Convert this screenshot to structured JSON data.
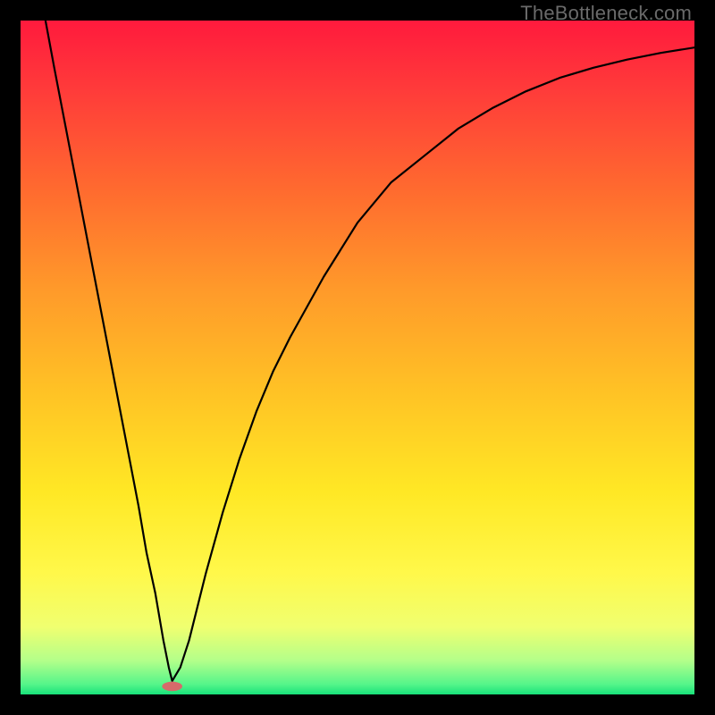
{
  "watermark": "TheBottleneck.com",
  "chart_data": {
    "type": "line",
    "title": "",
    "xlabel": "",
    "ylabel": "",
    "xlim": [
      0,
      100
    ],
    "ylim": [
      0,
      100
    ],
    "grid": false,
    "series": [
      {
        "name": "curve",
        "x": [
          3.7,
          5,
          7.5,
          10,
          12.5,
          15,
          17.5,
          18.7,
          20,
          21.2,
          22,
          22.5,
          23.7,
          25,
          27.5,
          30,
          32.5,
          35,
          37.5,
          40,
          45,
          50,
          55,
          60,
          65,
          70,
          75,
          80,
          85,
          90,
          95,
          100
        ],
        "y": [
          100,
          93,
          80,
          67,
          54,
          41,
          28,
          21,
          15,
          8,
          4,
          2,
          4,
          8,
          18,
          27,
          35,
          42,
          48,
          53,
          62,
          70,
          76,
          80,
          84,
          87,
          89.5,
          91.5,
          93,
          94.2,
          95.2,
          96
        ]
      }
    ],
    "marker": {
      "x": 22.5,
      "y": 1.2,
      "color": "#d66a6a",
      "rx": 1.5,
      "ry": 0.7
    },
    "gradient_stops": [
      {
        "offset": 0.0,
        "color": "#ff1a3d"
      },
      {
        "offset": 0.1,
        "color": "#ff3a3a"
      },
      {
        "offset": 0.25,
        "color": "#ff6a2f"
      },
      {
        "offset": 0.4,
        "color": "#ff9a2a"
      },
      {
        "offset": 0.55,
        "color": "#ffc225"
      },
      {
        "offset": 0.7,
        "color": "#ffe825"
      },
      {
        "offset": 0.82,
        "color": "#fff84a"
      },
      {
        "offset": 0.9,
        "color": "#f0ff70"
      },
      {
        "offset": 0.95,
        "color": "#b3ff8a"
      },
      {
        "offset": 0.985,
        "color": "#55f58a"
      },
      {
        "offset": 1.0,
        "color": "#18e27a"
      }
    ]
  }
}
